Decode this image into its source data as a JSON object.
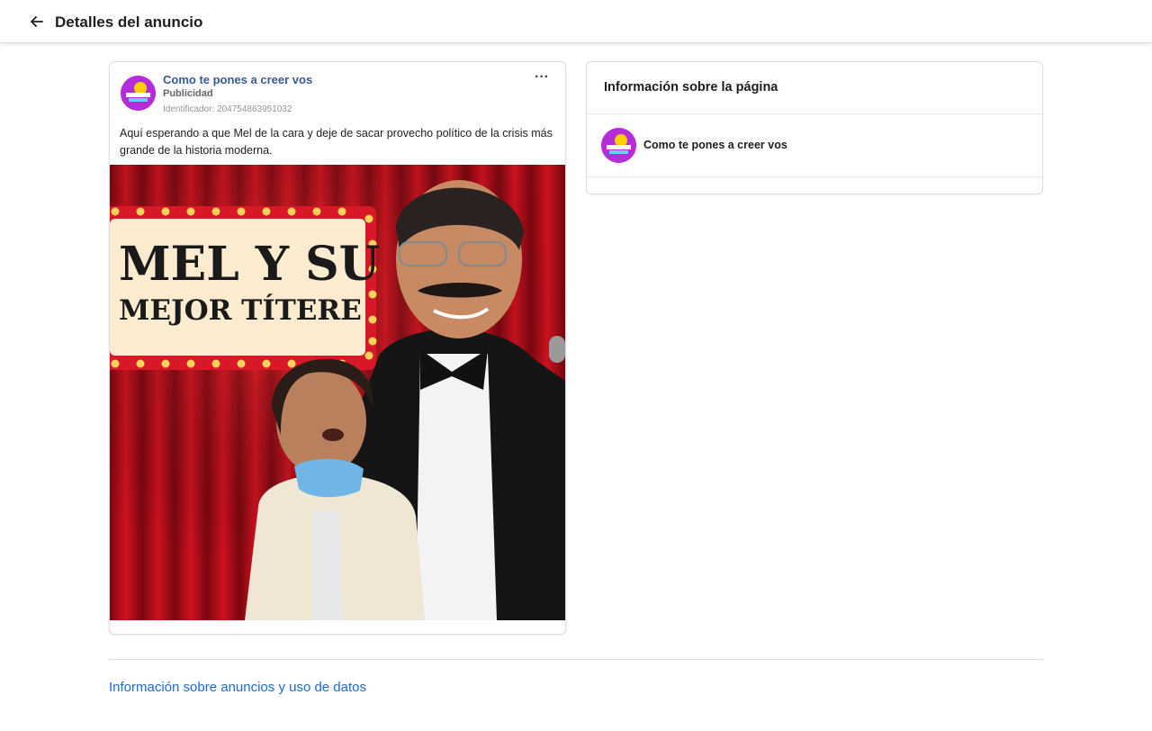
{
  "header": {
    "title": "Detalles del anuncio",
    "back_icon": "arrow-left-icon"
  },
  "ad": {
    "page_name": "Como te pones a creer vos",
    "sponsored_label": "Publicidad",
    "identifier": "Identificador: 204754863951032",
    "menu_label": "···",
    "body_text": "Aquí esperando a que Mel de la cara y deje de sacar provecho político de la crisis más grande de la historia moderna.",
    "image": {
      "headline_line1": "MEL Y SU",
      "headline_line2": "MEJOR TÍTERE"
    }
  },
  "page_info": {
    "title": "Información sobre la página",
    "page_name": "Como te pones a creer vos"
  },
  "footer": {
    "link_label": "Información sobre anuncios y uso de datos"
  },
  "colors": {
    "link_blue": "#385898",
    "footer_link_blue": "#1d6ad0",
    "avatar_purple": "#b52cd9",
    "curtain_red": "#c0101c",
    "marquee_gold": "#ffd35a"
  }
}
